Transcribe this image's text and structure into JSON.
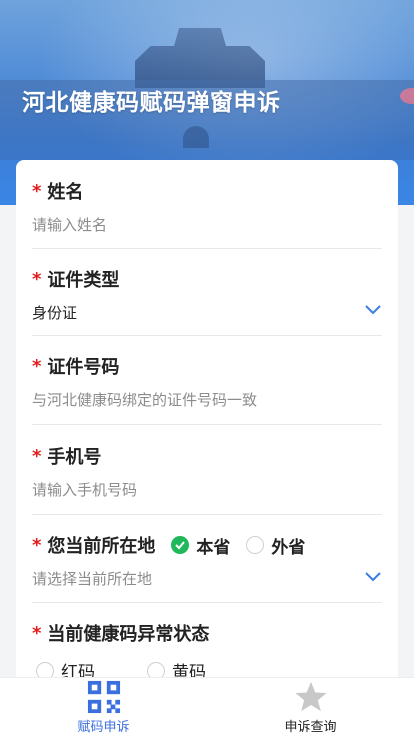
{
  "header": {
    "title": "河北健康码赋码弹窗申诉"
  },
  "form": {
    "required_mark": "*",
    "name": {
      "label": "姓名",
      "placeholder": "请输入姓名"
    },
    "id_type": {
      "label": "证件类型",
      "value": "身份证"
    },
    "id_number": {
      "label": "证件号码",
      "placeholder": "与河北健康码绑定的证件号码一致"
    },
    "phone": {
      "label": "手机号",
      "placeholder": "请输入手机号码"
    },
    "location": {
      "label": "您当前所在地",
      "options": [
        {
          "label": "本省",
          "selected": true
        },
        {
          "label": "外省",
          "selected": false
        }
      ],
      "placeholder": "请选择当前所在地"
    },
    "status": {
      "label": "当前健康码异常状态",
      "options": [
        {
          "label": "红码",
          "selected": false
        },
        {
          "label": "黄码",
          "selected": false
        }
      ]
    }
  },
  "tabs": [
    {
      "label": "赋码申诉",
      "icon": "qr-code-icon",
      "active": true,
      "color": "#3b6fe0"
    },
    {
      "label": "申诉查询",
      "icon": "star-icon",
      "active": false
    }
  ],
  "colors": {
    "accent": "#3b6fe0",
    "required": "#e01e1e",
    "radio_selected": "#1fb85a",
    "chevron": "#3b7de0"
  }
}
